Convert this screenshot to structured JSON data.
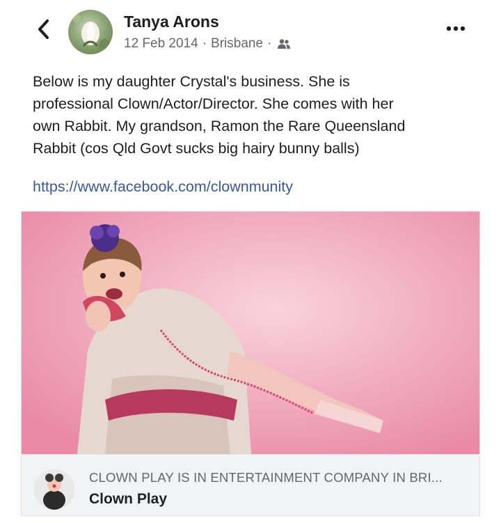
{
  "post": {
    "author": "Tanya Arons",
    "date": "12 Feb 2014",
    "location": "Brisbane",
    "separator": "·",
    "audience_icon": "friends-icon",
    "text": "Below is my daughter Crystal's business.  She is\nprofessional Clown/Actor/Director.  She comes with her\nown Rabbit.  My grandson, Ramon the Rare Queensland\nRabbit  (cos Qld Govt sucks big hairy bunny balls)",
    "link": "https://www.facebook.com/clownmunity"
  },
  "link_preview": {
    "domain": "CLOWN PLAY IS IN  ENTERTAINMENT COMPANY IN BRI...",
    "title": "Clown Play"
  },
  "icons": {
    "back": "back-chevron-icon",
    "more": "more-options-icon"
  },
  "colors": {
    "link": "#385898",
    "secondary_text": "#65676b",
    "card_background": "#f2f3f5",
    "image_background": "#ee9fb5"
  }
}
